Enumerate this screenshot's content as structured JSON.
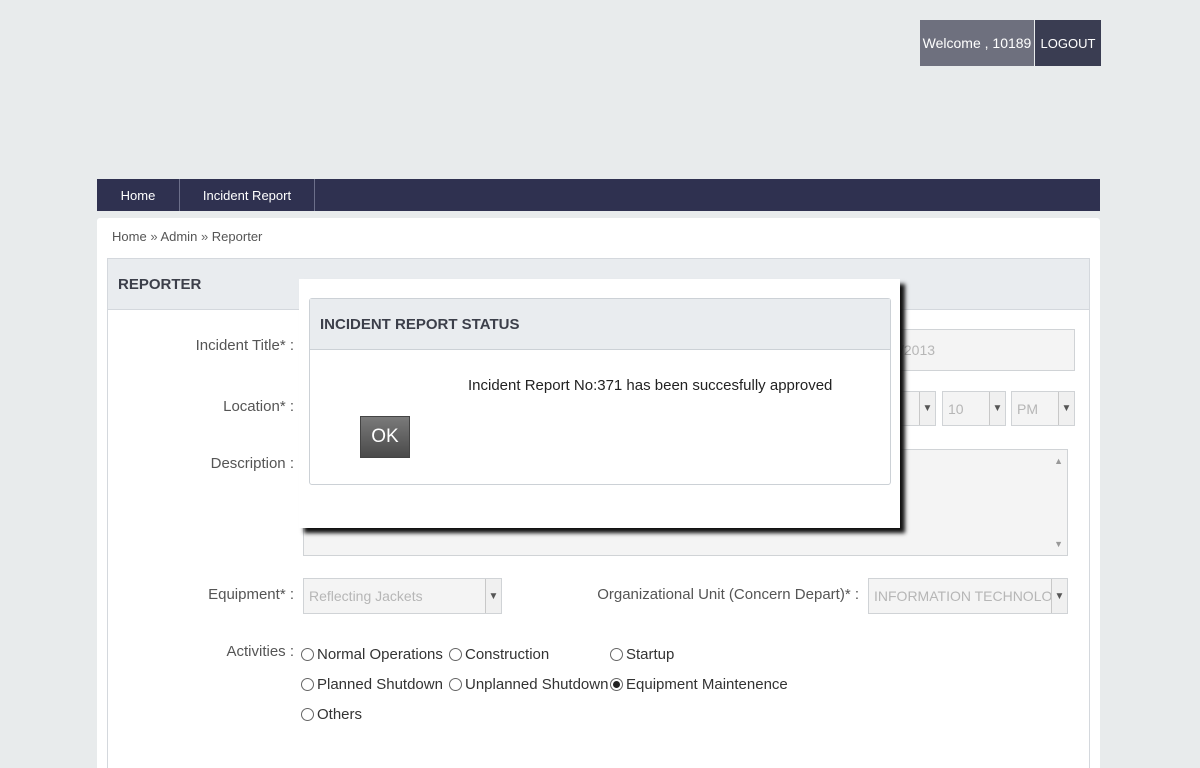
{
  "header": {
    "welcome": "Welcome , 10189",
    "logout": "LOGOUT"
  },
  "nav": {
    "home": "Home",
    "incident_report": "Incident Report"
  },
  "breadcrumb": {
    "home": "Home",
    "admin": "Admin",
    "reporter": "Reporter",
    "separator": "»"
  },
  "section": {
    "title": "REPORTER"
  },
  "form": {
    "incident_title_label": "Incident Title* :",
    "location_label": "Location* :",
    "description_label": "Description :",
    "date_value_partial": "/2013",
    "minute_value": "10",
    "ampm_value": "PM",
    "equipment_label": "Equipment* :",
    "equipment_value": "Reflecting Jackets",
    "org_unit_label": "Organizational Unit (Concern Depart)* :",
    "org_unit_value": "INFORMATION TECHNOLOG",
    "activities_label": "Activities :",
    "activities": [
      {
        "label": "Normal Operations",
        "checked": false
      },
      {
        "label": "Construction",
        "checked": false
      },
      {
        "label": "Startup",
        "checked": false
      },
      {
        "label": "Planned Shutdown",
        "checked": false
      },
      {
        "label": "Unplanned Shutdown",
        "checked": false
      },
      {
        "label": "Equipment Maintenence",
        "checked": true
      },
      {
        "label": "Others",
        "checked": false
      }
    ]
  },
  "modal": {
    "title": "INCIDENT REPORT STATUS",
    "message": "Incident Report No:371 has been succesfully approved",
    "ok": "OK"
  }
}
